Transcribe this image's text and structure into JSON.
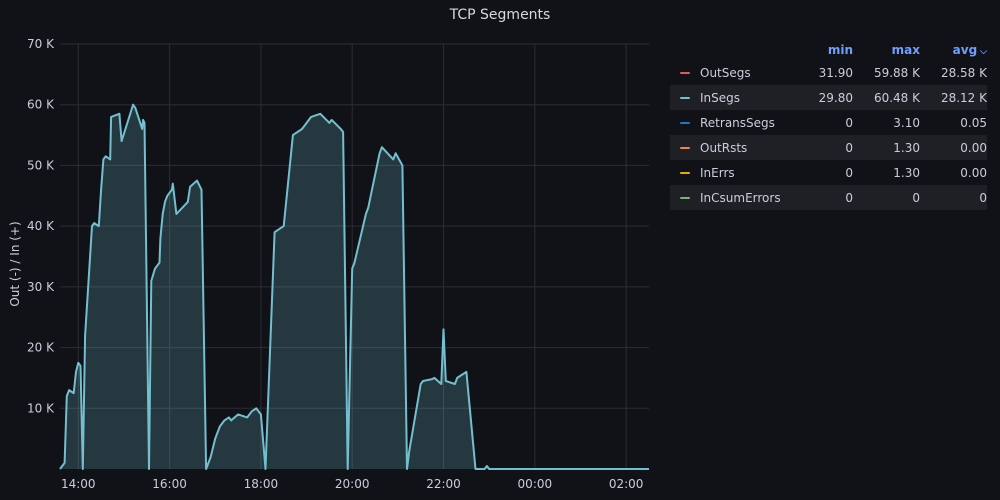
{
  "panel": {
    "title": "TCP Segments"
  },
  "chart_data": {
    "type": "area",
    "title": "TCP Segments",
    "ylabel": "Out (-) / In (+)",
    "xlabel": "",
    "ylim": [
      0,
      70000
    ],
    "y_ticks": [
      {
        "value": 10000,
        "label": "10 K"
      },
      {
        "value": 20000,
        "label": "20 K"
      },
      {
        "value": 30000,
        "label": "30 K"
      },
      {
        "value": 40000,
        "label": "40 K"
      },
      {
        "value": 50000,
        "label": "50 K"
      },
      {
        "value": 60000,
        "label": "60 K"
      },
      {
        "value": 70000,
        "label": "70 K"
      }
    ],
    "xlim_hours": [
      13.6,
      26.5
    ],
    "x_ticks": [
      {
        "hour": 14,
        "label": "14:00"
      },
      {
        "hour": 16,
        "label": "16:00"
      },
      {
        "hour": 18,
        "label": "18:00"
      },
      {
        "hour": 20,
        "label": "20:00"
      },
      {
        "hour": 22,
        "label": "22:00"
      },
      {
        "hour": 24,
        "label": "00:00"
      },
      {
        "hour": 26,
        "label": "02:00"
      }
    ],
    "grid": true,
    "series": [
      {
        "name": "InSegs",
        "color": "#73bfd0",
        "x_hours": [
          13.6,
          13.7,
          13.75,
          13.8,
          13.9,
          13.95,
          14.0,
          14.05,
          14.1,
          14.15,
          14.3,
          14.35,
          14.45,
          14.5,
          14.55,
          14.6,
          14.7,
          14.72,
          14.9,
          14.95,
          15.2,
          15.25,
          15.4,
          15.42,
          15.45,
          15.55,
          15.6,
          15.68,
          15.78,
          15.8,
          15.85,
          15.9,
          15.95,
          16.05,
          16.07,
          16.15,
          16.4,
          16.45,
          16.6,
          16.7,
          16.8,
          16.9,
          17.0,
          17.1,
          17.2,
          17.3,
          17.35,
          17.5,
          17.7,
          17.8,
          17.9,
          18.0,
          18.1,
          18.3,
          18.5,
          18.7,
          18.9,
          19.1,
          19.3,
          19.5,
          19.55,
          19.75,
          19.8,
          19.9,
          20.0,
          20.05,
          20.3,
          20.35,
          20.6,
          20.65,
          20.9,
          20.95,
          21.1,
          21.2,
          21.25,
          21.5,
          21.55,
          21.75,
          21.8,
          21.95,
          22.0,
          22.05,
          22.25,
          22.3,
          22.5,
          22.7,
          22.9,
          22.95,
          23.0,
          23.1,
          23.3,
          23.5,
          23.7,
          23.9,
          24.0,
          24.02,
          24.05,
          24.1,
          24.3,
          24.5,
          24.6,
          24.62,
          26.5
        ],
        "values": [
          0,
          1000,
          12000,
          13000,
          12500,
          16000,
          17500,
          17000,
          0,
          22000,
          40000,
          40500,
          40000,
          46000,
          51000,
          51500,
          51000,
          58000,
          58500,
          54000,
          60000,
          59500,
          56000,
          57500,
          57000,
          0,
          31000,
          33000,
          34000,
          38000,
          42000,
          44000,
          45000,
          46000,
          47000,
          42000,
          44000,
          46500,
          47500,
          46000,
          0,
          2000,
          5000,
          7000,
          8000,
          8500,
          8000,
          9000,
          8500,
          9500,
          10000,
          9000,
          0,
          39000,
          40000,
          55000,
          56000,
          58000,
          58500,
          57000,
          57500,
          56000,
          55500,
          0,
          33000,
          34000,
          42000,
          43000,
          52000,
          53000,
          51000,
          52000,
          50000,
          0,
          3000,
          14000,
          14500,
          14800,
          15000,
          14000,
          23000,
          14500,
          14000,
          15000,
          16000,
          0,
          0,
          500,
          0,
          0,
          0,
          0,
          0,
          0,
          0,
          0,
          0,
          0,
          0,
          0,
          0,
          0,
          0
        ]
      }
    ],
    "legend": {
      "placement": "right",
      "columns": [
        "min",
        "max",
        "avg"
      ],
      "rows": [
        {
          "name": "OutSegs",
          "color": "#e05a5a",
          "min": "31.90",
          "max": "59.88 K",
          "avg": "28.58 K"
        },
        {
          "name": "InSegs",
          "color": "#73bfd0",
          "min": "29.80",
          "max": "60.48 K",
          "avg": "28.12 K"
        },
        {
          "name": "RetransSegs",
          "color": "#1f78c1",
          "min": "0",
          "max": "3.10",
          "avg": "0.05"
        },
        {
          "name": "OutRsts",
          "color": "#ef843c",
          "min": "0",
          "max": "1.30",
          "avg": "0.00"
        },
        {
          "name": "InErrs",
          "color": "#e5ac0e",
          "min": "0",
          "max": "1.30",
          "avg": "0.00"
        },
        {
          "name": "InCsumErrors",
          "color": "#7eb26d",
          "min": "0",
          "max": "0",
          "avg": "0"
        }
      ]
    }
  }
}
